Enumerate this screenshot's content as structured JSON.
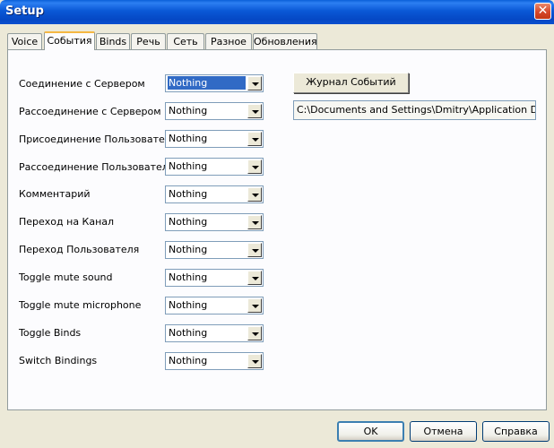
{
  "window": {
    "title": "Setup"
  },
  "tabs": [
    {
      "label": "Voice"
    },
    {
      "label": "События"
    },
    {
      "label": "Binds"
    },
    {
      "label": "Речь"
    },
    {
      "label": "Сеть"
    },
    {
      "label": "Разное"
    },
    {
      "label": "Обновления"
    }
  ],
  "events": [
    {
      "label": "Соединение с Сервером",
      "value": "Nothing"
    },
    {
      "label": "Рассоединение с Сервером",
      "value": "Nothing"
    },
    {
      "label": "Присоединение Пользователя",
      "value": "Nothing"
    },
    {
      "label": "Рассоединение Пользователя",
      "value": "Nothing"
    },
    {
      "label": "Комментарий",
      "value": "Nothing"
    },
    {
      "label": "Переход на Канал",
      "value": "Nothing"
    },
    {
      "label": "Переход Пользователя",
      "value": "Nothing"
    },
    {
      "label": "Toggle mute sound",
      "value": "Nothing"
    },
    {
      "label": "Toggle mute microphone",
      "value": "Nothing"
    },
    {
      "label": "Toggle Binds",
      "value": "Nothing"
    },
    {
      "label": "Switch Bindings",
      "value": "Nothing"
    }
  ],
  "log": {
    "button_label": "Журнал Событий",
    "path": "C:\\Documents and Settings\\Dmitry\\Application Data\\Ve"
  },
  "footer": {
    "ok_label": "OK",
    "cancel_label": "Отмена",
    "help_label": "Справка"
  }
}
